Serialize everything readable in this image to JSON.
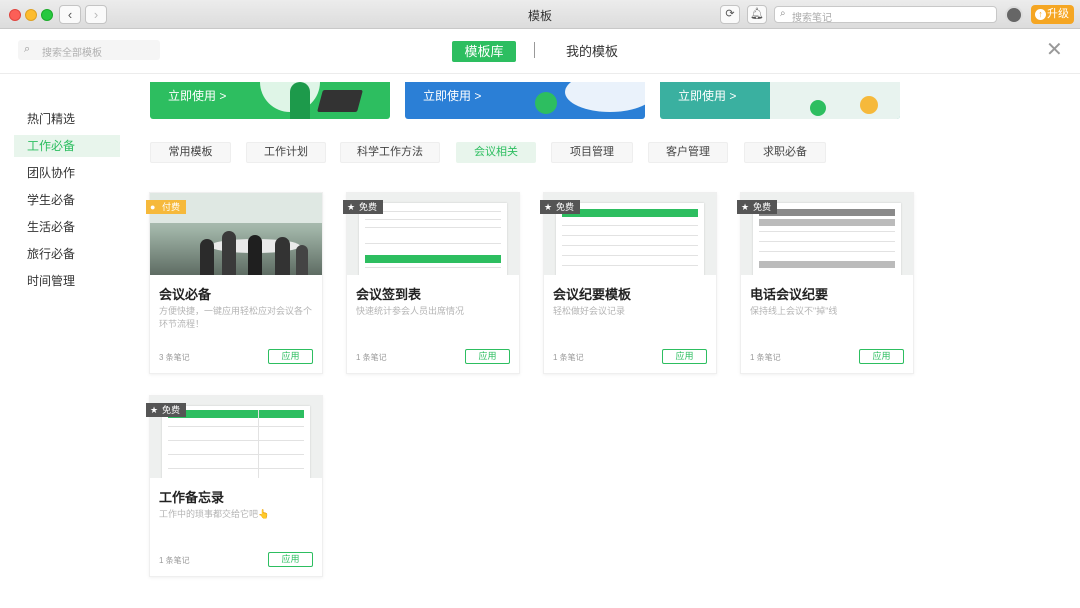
{
  "window": {
    "title": "模板"
  },
  "toolbar": {
    "search_placeholder": "搜索笔记",
    "upgrade_label": "升级"
  },
  "header": {
    "search_placeholder": "搜索全部模板",
    "tabs": [
      {
        "label": "模板库",
        "active": true
      },
      {
        "label": "我的模板",
        "active": false
      }
    ]
  },
  "sidebar": {
    "items": [
      {
        "label": "热门精选"
      },
      {
        "label": "工作必备",
        "active": true
      },
      {
        "label": "团队协作"
      },
      {
        "label": "学生必备"
      },
      {
        "label": "生活必备"
      },
      {
        "label": "旅行必备"
      },
      {
        "label": "时间管理"
      }
    ]
  },
  "banners": [
    {
      "label": "立即使用 >",
      "color": "#2dbe60"
    },
    {
      "label": "立即使用 >",
      "color": "#2b7fd6"
    },
    {
      "label": "立即使用 >",
      "color": "#3ab0a0"
    }
  ],
  "categories": [
    {
      "label": "常用模板"
    },
    {
      "label": "工作计划"
    },
    {
      "label": "科学工作方法"
    },
    {
      "label": "会议相关",
      "active": true
    },
    {
      "label": "项目管理"
    },
    {
      "label": "客户管理"
    },
    {
      "label": "求职必备"
    }
  ],
  "cards": [
    {
      "badge": "付费",
      "title": "会议必备",
      "desc": "方便快捷，一键应用轻松应对会议各个环节流程！",
      "count": "3 条笔记",
      "button": "应用"
    },
    {
      "badge": "免费",
      "title": "会议签到表",
      "desc": "快速统计参会人员出席情况",
      "count": "1 条笔记",
      "button": "应用"
    },
    {
      "badge": "免费",
      "title": "会议纪要模板",
      "desc": "轻松做好会议记录",
      "count": "1 条笔记",
      "button": "应用"
    },
    {
      "badge": "免费",
      "title": "电话会议纪要",
      "desc": "保持线上会议不\"掉\"线",
      "count": "1 条笔记",
      "button": "应用"
    },
    {
      "badge": "免费",
      "title": "工作备忘录",
      "desc": "工作中的琐事都交给它吧👆",
      "count": "1 条笔记",
      "button": "应用"
    }
  ],
  "colors": {
    "accent": "#2dbe60",
    "paid": "#f6b93b"
  }
}
